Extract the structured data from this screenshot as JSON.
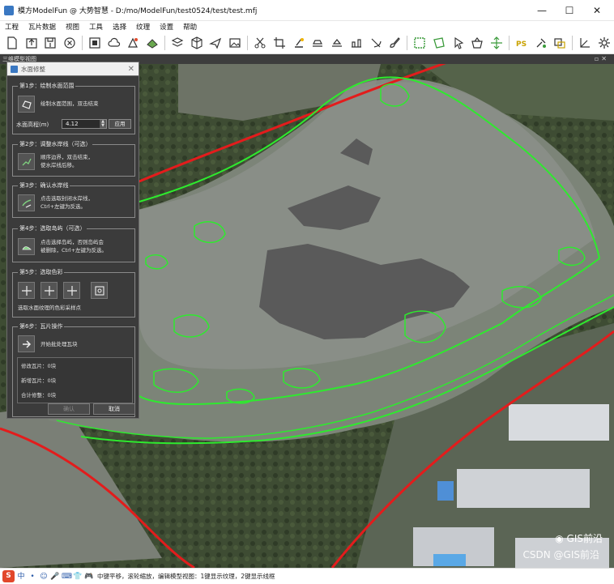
{
  "window": {
    "title": "模方ModelFun @ 大势智慧 - D:/mo/ModelFun/test0524/test/test.mfj",
    "controls": [
      "—",
      "☐",
      "✕"
    ]
  },
  "menu": [
    "工程",
    "瓦片数据",
    "视图",
    "工具",
    "选择",
    "纹理",
    "设置",
    "帮助"
  ],
  "toolbar": {
    "icons": [
      "new-file",
      "open-file",
      "save-file",
      "close-project",
      "stop",
      "cloud-upload",
      "export",
      "model-tool",
      "layers",
      "cube",
      "airplane",
      "image",
      "scissors",
      "crop",
      "clear",
      "fill",
      "flatten",
      "bridge",
      "water",
      "brush",
      "select-rect",
      "select-poly",
      "pointer",
      "basket",
      "move-plane",
      "photoshop",
      "texture-swap",
      "repair",
      "axis",
      "settings"
    ]
  },
  "view": {
    "label": "三维模型视图"
  },
  "panel": {
    "title": "水面修整",
    "steps": [
      {
        "title": "第1步：绘制水面范围",
        "text": [
          "绘制水面范围，双击结束"
        ]
      },
      {
        "title": "第2步：调整水岸线（可选）",
        "text": [
          "顺序边界，双击结束，",
          "使水岸线后移。"
        ]
      },
      {
        "title": "第3步：确认水岸线",
        "text": [
          "点击选取封闭水岸线，",
          "Ctrl+左键为反选。"
        ]
      },
      {
        "title": "第4步：选取岛屿（可选）",
        "text": [
          "点击选择岛屿，否则岛屿会",
          "被删除，Ctrl+左键为反选。"
        ]
      },
      {
        "title": "第5步：选取色彩",
        "text": [
          "选取水面纹理的色彩采样点"
        ]
      },
      {
        "title": "第6步：瓦片操作",
        "text": [
          "开始批处理瓦块"
        ]
      }
    ],
    "elevation_label": "水面高程(m)",
    "elevation_value": "4.12",
    "apply_label": "应用",
    "stats": [
      "修改瓦片：0块",
      "新增瓦片：0块",
      "合计修整：0块"
    ],
    "ok_label": "确认",
    "cancel_label": "取消"
  },
  "status": {
    "ime_letter": "S",
    "ime_glyphs": [
      "中",
      "•",
      "☺",
      "🎤",
      "⌨",
      "👕",
      "🎮"
    ],
    "text": "中键平移，滚轮缩放，编辑模型视图：1键显示纹理，2键显示线框"
  },
  "watermark": {
    "csdn": "CSDN @GIS前沿",
    "account": "GIS前沿"
  },
  "colors": {
    "water_outline": "#2eea2e",
    "road_line": "#e31c1c",
    "water_fill": "#5a5a5a",
    "panel_bg": "#3b3b3b"
  }
}
